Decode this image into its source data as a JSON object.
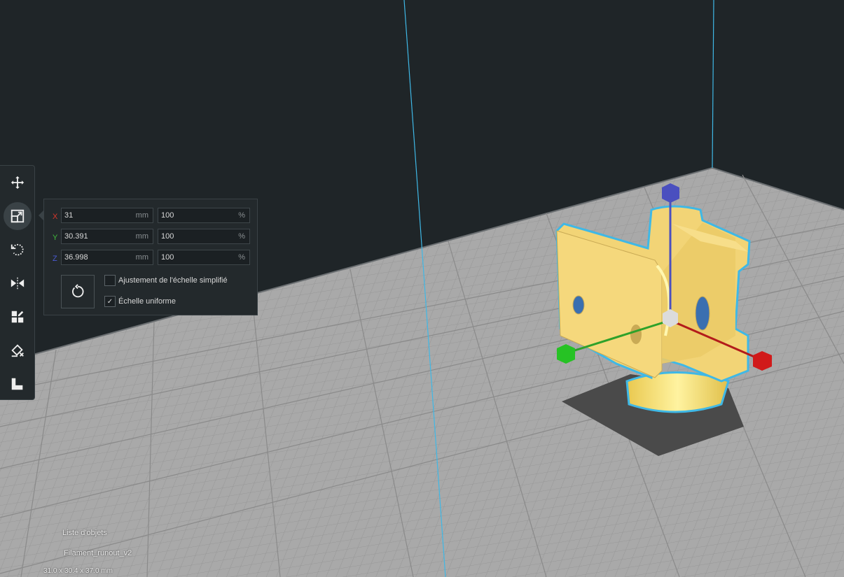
{
  "app": {
    "accent_color": "#3fb8e6",
    "background_color": "#1f2528"
  },
  "toolbar": {
    "tools": [
      {
        "name": "move",
        "icon": "move-icon"
      },
      {
        "name": "scale",
        "icon": "scale-icon",
        "active": true
      },
      {
        "name": "rotate",
        "icon": "rotate-icon"
      },
      {
        "name": "mirror",
        "icon": "mirror-icon"
      },
      {
        "name": "per-model-settings",
        "icon": "per-model-settings-icon"
      },
      {
        "name": "support-blocker",
        "icon": "support-blocker-icon"
      },
      {
        "name": "lay-flat",
        "icon": "lay-flat-icon"
      }
    ]
  },
  "scale_panel": {
    "x": {
      "label": "X",
      "mm": "31",
      "percent": "100",
      "color": "#d9362b"
    },
    "y": {
      "label": "Y",
      "mm": "30.391",
      "percent": "100",
      "color": "#40b93c"
    },
    "z": {
      "label": "Z",
      "mm": "36.998",
      "percent": "100",
      "color": "#4a5bd4"
    },
    "unit_mm": "mm",
    "unit_percent": "%",
    "snap_scaling": {
      "label": "Ajustement de l'échelle simplifié",
      "checked": false
    },
    "uniform_scaling": {
      "label": "Échelle uniforme",
      "checked": true,
      "check_mark": "✓"
    }
  },
  "object_info": {
    "list_toggle_label": "Liste d'objets",
    "object_name": "Filament_runout_v2",
    "dimensions": "31.0 x 30.4 x 37.0 mm"
  },
  "model_color": "#f0d070"
}
